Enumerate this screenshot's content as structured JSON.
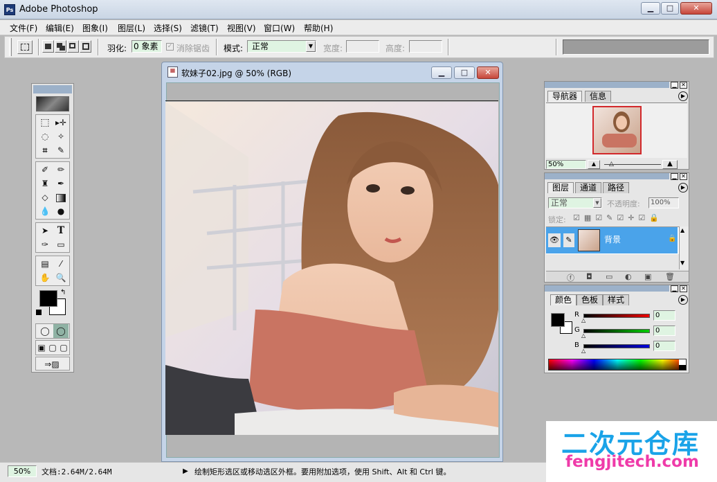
{
  "window": {
    "title": "Adobe Photoshop",
    "min": "▁",
    "max": "□",
    "close": "✕"
  },
  "menu": [
    "文件(F)",
    "编辑(E)",
    "图象(I)",
    "图层(L)",
    "选择(S)",
    "滤镜(T)",
    "视图(V)",
    "窗口(W)",
    "帮助(H)"
  ],
  "options": {
    "feather_label": "羽化:",
    "feather_value": "0 象素",
    "antialias_label": "消除锯齿",
    "mode_label": "模式:",
    "mode_value": "正常",
    "width_label": "宽度:",
    "height_label": "高度:"
  },
  "document": {
    "title": "软妹子02.jpg @ 50% (RGB)"
  },
  "navigator": {
    "tabs": [
      "导航器",
      "信息"
    ],
    "zoom": "50%"
  },
  "layers": {
    "tabs": [
      "图层",
      "通道",
      "路径"
    ],
    "blend_mode": "正常",
    "opacity_label": "不透明度:",
    "opacity_value": "100%",
    "lock_label": "锁定:",
    "layer_name": "背景"
  },
  "color": {
    "tabs": [
      "颜色",
      "色板",
      "样式"
    ],
    "channels": [
      {
        "name": "R",
        "value": "0"
      },
      {
        "name": "G",
        "value": "0"
      },
      {
        "name": "B",
        "value": "0"
      }
    ]
  },
  "status": {
    "zoom": "50%",
    "doc_size": "文档:2.64M/2.64M",
    "hint": "绘制矩形选区或移动选区外框。要用附加选项，使用 Shift、Alt 和 Ctrl 键。"
  },
  "watermark": {
    "title": "二次元仓库",
    "url": "fengjitech.com"
  },
  "colors": {
    "accent": "#4aa3ea",
    "titlebar": "#c9d5e4",
    "workspace": "#b8b8b8"
  }
}
